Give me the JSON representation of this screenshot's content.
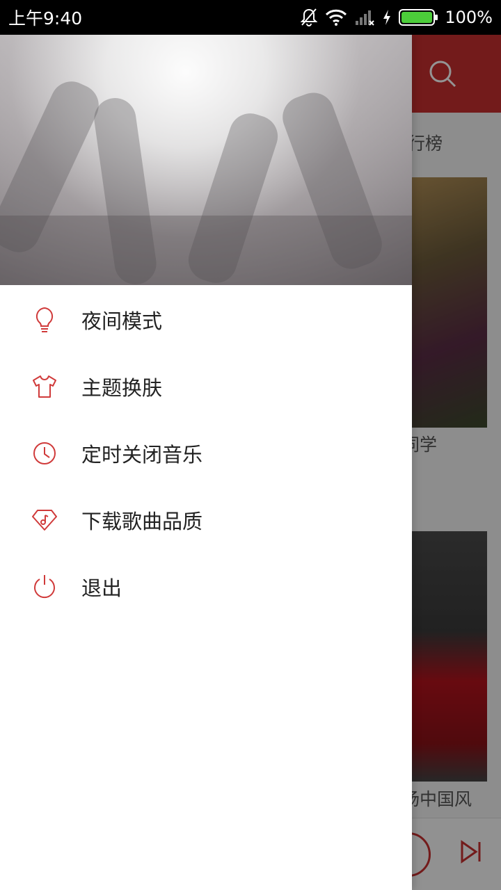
{
  "status_bar": {
    "time": "上午9:40",
    "battery_percent_text": "100%",
    "battery_level": 1.0,
    "icons": [
      "mute-bell-icon",
      "wifi-icon",
      "signal-icon",
      "charging-icon",
      "battery-icon"
    ]
  },
  "background": {
    "tab_fragment": "行榜",
    "caption_1": "同学",
    "caption_2": "扬中国风",
    "accent_color": "#c62f2f"
  },
  "drawer": {
    "header_image": "concert-crowd-hands",
    "menu": [
      {
        "label": "夜间模式",
        "icon": "lightbulb-icon"
      },
      {
        "label": "主题换肤",
        "icon": "tshirt-icon"
      },
      {
        "label": "定时关闭音乐",
        "icon": "clock-icon"
      },
      {
        "label": "下载歌曲品质",
        "icon": "music-quality-icon"
      },
      {
        "label": "退出",
        "icon": "power-icon"
      }
    ]
  }
}
